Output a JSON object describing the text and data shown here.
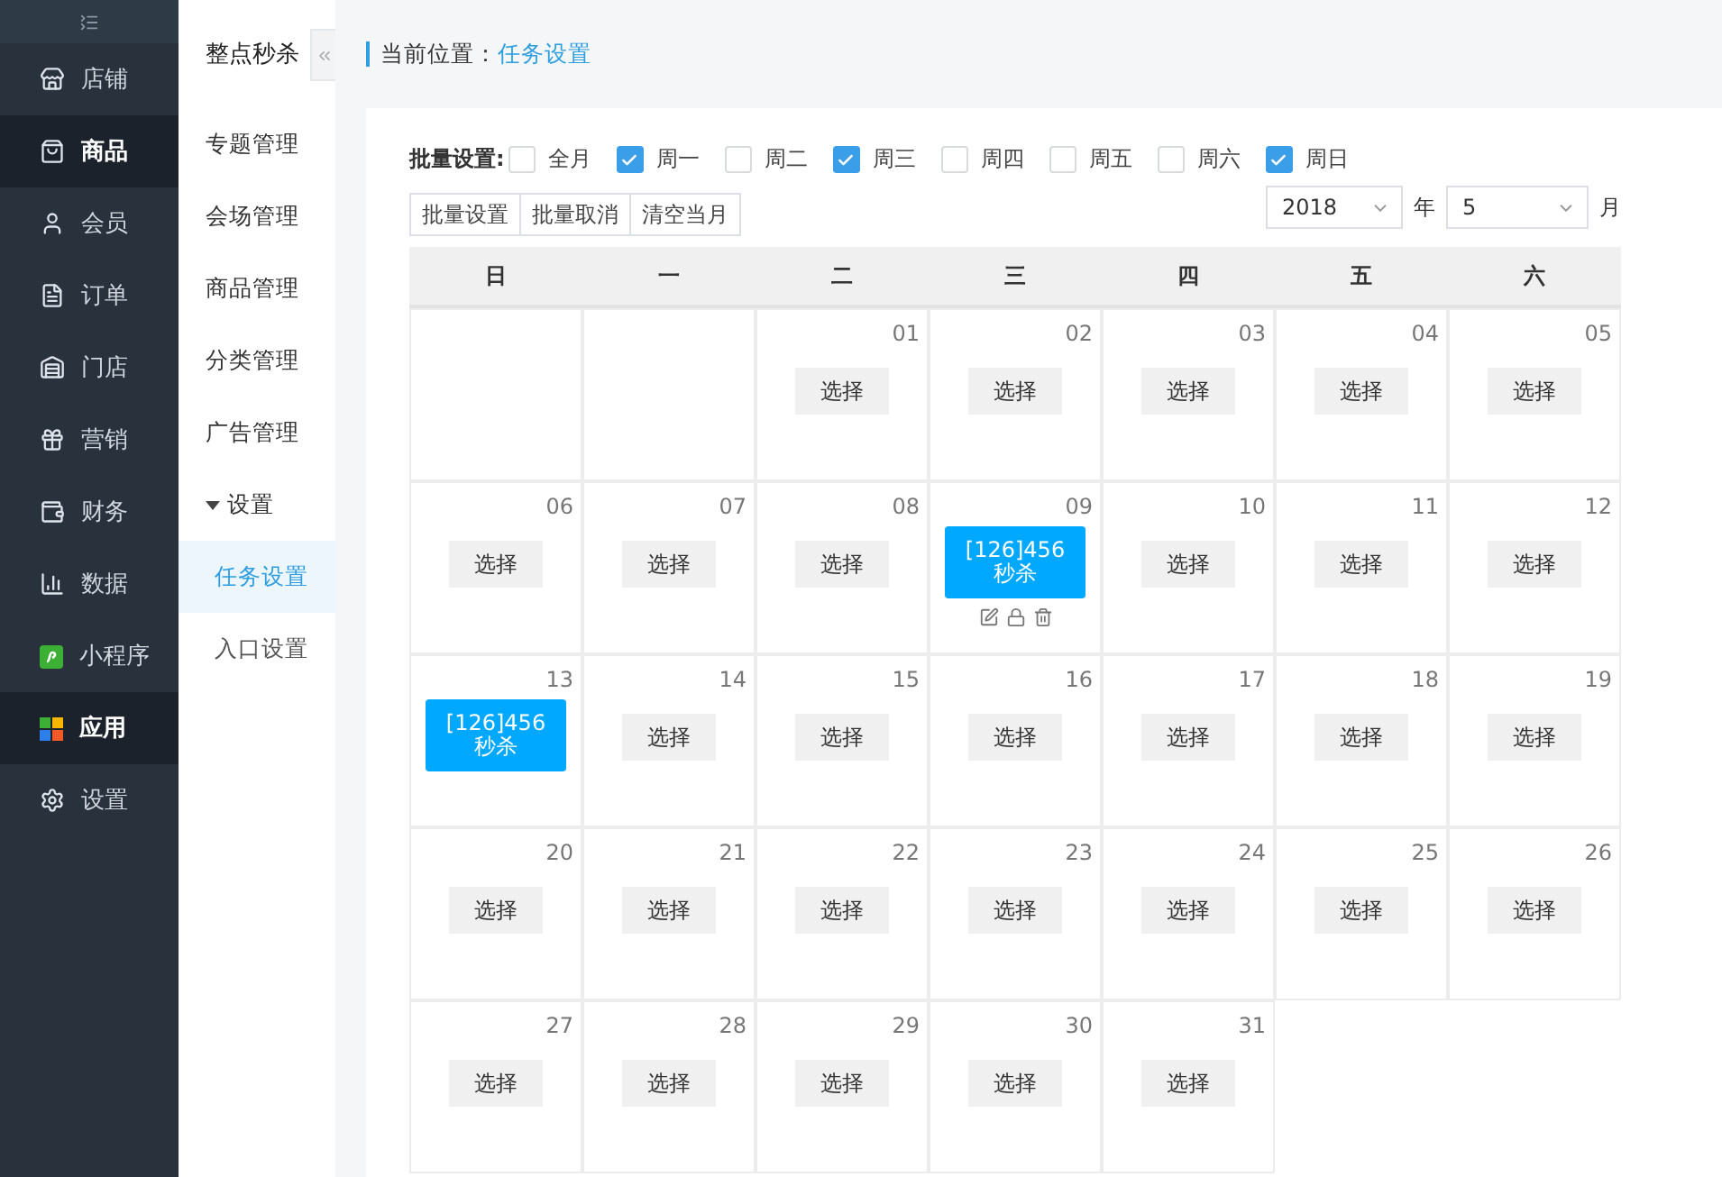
{
  "nav": [
    {
      "label": "店铺",
      "selected": false
    },
    {
      "label": "商品",
      "selected": true
    },
    {
      "label": "会员",
      "selected": false
    },
    {
      "label": "订单",
      "selected": false
    },
    {
      "label": "门店",
      "selected": false
    },
    {
      "label": "营销",
      "selected": false
    },
    {
      "label": "财务",
      "selected": false
    },
    {
      "label": "数据",
      "selected": false
    },
    {
      "label": "小程序",
      "selected": false
    },
    {
      "label": "应用",
      "selected": true
    },
    {
      "label": "设置",
      "selected": false
    }
  ],
  "subnav": {
    "title": "整点秒杀",
    "items": [
      {
        "label": "专题管理",
        "selected": false
      },
      {
        "label": "会场管理",
        "selected": false
      },
      {
        "label": "商品管理",
        "selected": false
      },
      {
        "label": "分类管理",
        "selected": false
      },
      {
        "label": "广告管理",
        "selected": false
      },
      {
        "label": "设置",
        "expanded": true,
        "selected": false,
        "children": [
          {
            "label": "任务设置",
            "selected": true
          },
          {
            "label": "入口设置",
            "selected": false
          }
        ]
      }
    ]
  },
  "breadcrumb": {
    "label": "当前位置：",
    "current": "任务设置"
  },
  "batch": {
    "label": "批量设置:",
    "options": [
      {
        "label": "全月",
        "checked": false
      },
      {
        "label": "周一",
        "checked": true
      },
      {
        "label": "周二",
        "checked": false
      },
      {
        "label": "周三",
        "checked": true
      },
      {
        "label": "周四",
        "checked": false
      },
      {
        "label": "周五",
        "checked": false
      },
      {
        "label": "周六",
        "checked": false
      },
      {
        "label": "周日",
        "checked": true
      }
    ],
    "buttons": [
      "批量设置",
      "批量取消",
      "清空当月"
    ]
  },
  "year": {
    "value": "2018",
    "unit": "年"
  },
  "month": {
    "value": "5",
    "unit": "月"
  },
  "weekdays": [
    "日",
    "一",
    "二",
    "三",
    "四",
    "五",
    "六"
  ],
  "weeks": [
    [
      {
        "kind": "empty"
      },
      {
        "kind": "empty"
      },
      {
        "kind": "select",
        "day": "01",
        "button": "选择"
      },
      {
        "kind": "select",
        "day": "02",
        "button": "选择"
      },
      {
        "kind": "select",
        "day": "03",
        "button": "选择"
      },
      {
        "kind": "select",
        "day": "04",
        "button": "选择"
      },
      {
        "kind": "select",
        "day": "05",
        "button": "选择"
      }
    ],
    [
      {
        "kind": "select",
        "day": "06",
        "button": "选择"
      },
      {
        "kind": "select",
        "day": "07",
        "button": "选择"
      },
      {
        "kind": "select",
        "day": "08",
        "button": "选择"
      },
      {
        "kind": "task",
        "day": "09",
        "lines": [
          "[126]456",
          "秒杀"
        ],
        "actions": true
      },
      {
        "kind": "select",
        "day": "10",
        "button": "选择"
      },
      {
        "kind": "select",
        "day": "11",
        "button": "选择"
      },
      {
        "kind": "select",
        "day": "12",
        "button": "选择"
      }
    ],
    [
      {
        "kind": "task",
        "day": "13",
        "lines": [
          "[126]456",
          "秒杀"
        ],
        "actions": false
      },
      {
        "kind": "select",
        "day": "14",
        "button": "选择"
      },
      {
        "kind": "select",
        "day": "15",
        "button": "选择"
      },
      {
        "kind": "select",
        "day": "16",
        "button": "选择"
      },
      {
        "kind": "select",
        "day": "17",
        "button": "选择"
      },
      {
        "kind": "select",
        "day": "18",
        "button": "选择"
      },
      {
        "kind": "select",
        "day": "19",
        "button": "选择"
      }
    ],
    [
      {
        "kind": "select",
        "day": "20",
        "button": "选择"
      },
      {
        "kind": "select",
        "day": "21",
        "button": "选择"
      },
      {
        "kind": "select",
        "day": "22",
        "button": "选择"
      },
      {
        "kind": "select",
        "day": "23",
        "button": "选择"
      },
      {
        "kind": "select",
        "day": "24",
        "button": "选择"
      },
      {
        "kind": "select",
        "day": "25",
        "button": "选择"
      },
      {
        "kind": "select",
        "day": "26",
        "button": "选择"
      }
    ],
    [
      {
        "kind": "select",
        "day": "27",
        "button": "选择"
      },
      {
        "kind": "select",
        "day": "28",
        "button": "选择"
      },
      {
        "kind": "select",
        "day": "29",
        "button": "选择"
      },
      {
        "kind": "select",
        "day": "30",
        "button": "选择"
      },
      {
        "kind": "select",
        "day": "31",
        "button": "选择"
      }
    ]
  ]
}
